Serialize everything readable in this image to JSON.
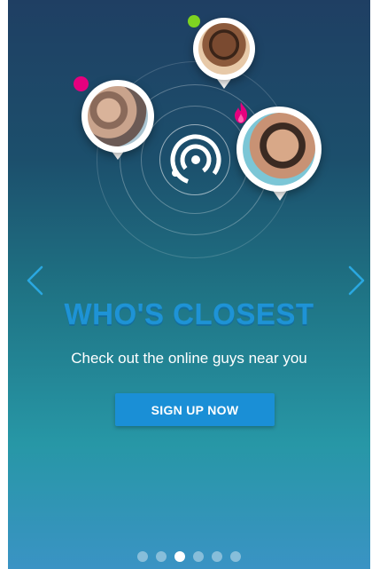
{
  "onboarding": {
    "headline": "WHO'S CLOSEST",
    "subline": "Check out the online guys near you",
    "signup_label": "SIGN UP NOW"
  },
  "pager": {
    "total": 6,
    "active_index": 2
  },
  "colors": {
    "accent": "#1a8fd6",
    "headline": "#1e93d6",
    "arrow": "#2aa7e0",
    "online_dot": "#7ed321",
    "notify_dot": "#e5007e"
  },
  "icons": {
    "left_arrow": "chevron-left-icon",
    "right_arrow": "chevron-right-icon",
    "logo": "radar-logo-icon",
    "flame": "flame-icon"
  }
}
